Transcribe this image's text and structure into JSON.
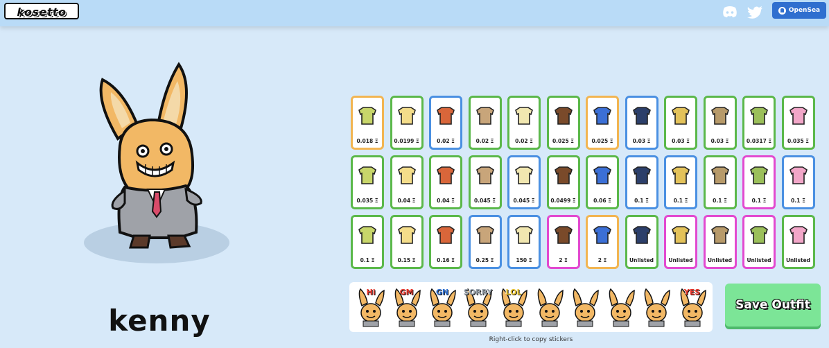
{
  "header": {
    "logo_text": "kosetto",
    "discord_icon": "discord-icon",
    "twitter_icon": "twitter-icon",
    "opensea_label": "OpenSea"
  },
  "character": {
    "name": "kenny"
  },
  "items": [
    {
      "price": "0.018 Ξ",
      "color": "#f2b552",
      "icon": "crop-top-icon"
    },
    {
      "price": "0.0199 Ξ",
      "color": "#5bb84a",
      "icon": "shirt-icon"
    },
    {
      "price": "0.02 Ξ",
      "color": "#4a90e2",
      "icon": "jacket-icon"
    },
    {
      "price": "0.02 Ξ",
      "color": "#5bb84a",
      "icon": "vest-icon"
    },
    {
      "price": "0.02 Ξ",
      "color": "#5bb84a",
      "icon": "scarf-icon"
    },
    {
      "price": "0.025 Ξ",
      "color": "#5bb84a",
      "icon": "stick-icon"
    },
    {
      "price": "0.025 Ξ",
      "color": "#f2b552",
      "icon": "sunglasses-icon"
    },
    {
      "price": "0.03 Ξ",
      "color": "#4a90e2",
      "icon": "tshirt-icon"
    },
    {
      "price": "0.03 Ξ",
      "color": "#5bb84a",
      "icon": "crop-top-icon"
    },
    {
      "price": "0.03 Ξ",
      "color": "#5bb84a",
      "icon": "vest-icon"
    },
    {
      "price": "0.0317 Ξ",
      "color": "#5bb84a",
      "icon": "cup-icon"
    },
    {
      "price": "0.035 Ξ",
      "color": "#5bb84a",
      "icon": "pink-top-icon"
    },
    {
      "price": "0.035 Ξ",
      "color": "#5bb84a",
      "icon": "bra-icon"
    },
    {
      "price": "0.04 Ξ",
      "color": "#5bb84a",
      "icon": "spiral-glasses-icon"
    },
    {
      "price": "0.04 Ξ",
      "color": "#5bb84a",
      "icon": "purple-hat-icon"
    },
    {
      "price": "0.045 Ξ",
      "color": "#5bb84a",
      "icon": "bottle-icon"
    },
    {
      "price": "0.045 Ξ",
      "color": "#4a90e2",
      "icon": "mask-icon"
    },
    {
      "price": "0.0499 Ξ",
      "color": "#5bb84a",
      "icon": "bow-icon"
    },
    {
      "price": "0.06 Ξ",
      "color": "#5bb84a",
      "icon": "collar-icon"
    },
    {
      "price": "0.1 Ξ",
      "color": "#4a90e2",
      "icon": "hoodie-icon"
    },
    {
      "price": "0.1 Ξ",
      "color": "#4a90e2",
      "icon": "bucket-hat-icon"
    },
    {
      "price": "0.1 Ξ",
      "color": "#5bb84a",
      "icon": "earrings-icon"
    },
    {
      "price": "0.1 Ξ",
      "color": "#e24ad0",
      "icon": "earrings-icon"
    },
    {
      "price": "0.1 Ξ",
      "color": "#4a90e2",
      "icon": "headphones-icon"
    },
    {
      "price": "0.1 Ξ",
      "color": "#5bb84a",
      "icon": "tank-top-icon"
    },
    {
      "price": "0.15 Ξ",
      "color": "#5bb84a",
      "icon": "grey-shirt-icon"
    },
    {
      "price": "0.16 Ξ",
      "color": "#5bb84a",
      "icon": "cake-icon"
    },
    {
      "price": "0.25 Ξ",
      "color": "#4a90e2",
      "icon": "green-shirt-icon"
    },
    {
      "price": "150 Ξ",
      "color": "#4a90e2",
      "icon": "branch-icon"
    },
    {
      "price": "2 Ξ",
      "color": "#e24ad0",
      "icon": "suit-icon"
    },
    {
      "price": "2 Ξ",
      "color": "#f2b552",
      "icon": "bunny-ears-icon"
    },
    {
      "price": "Unlisted",
      "color": "#5bb84a",
      "icon": "white-top-icon"
    },
    {
      "price": "Unlisted",
      "color": "#e24ad0",
      "icon": "black-top-icon"
    },
    {
      "price": "Unlisted",
      "color": "#e24ad0",
      "icon": "necklace-icon"
    },
    {
      "price": "Unlisted",
      "color": "#e24ad0",
      "icon": "pink-skirt-icon"
    },
    {
      "price": "Unlisted",
      "color": "#5bb84a",
      "icon": "gift-box-icon"
    }
  ],
  "stickers": [
    {
      "label": "Hi",
      "color": "#e8372c"
    },
    {
      "label": "GM",
      "color": "#e8372c"
    },
    {
      "label": "GN",
      "color": "#2f6fcf"
    },
    {
      "label": "SORRY",
      "color": "#9aa3ad"
    },
    {
      "label": "LOL",
      "color": "#e8c22c"
    },
    {
      "label": "",
      "color": "#333333"
    },
    {
      "label": "",
      "color": "#333333"
    },
    {
      "label": "",
      "color": "#333333"
    },
    {
      "label": "",
      "color": "#333333"
    },
    {
      "label": "YES",
      "color": "#e8372c"
    }
  ],
  "sticker_caption": "Right-click to copy stickers",
  "save_button_label": "Save Outfit"
}
